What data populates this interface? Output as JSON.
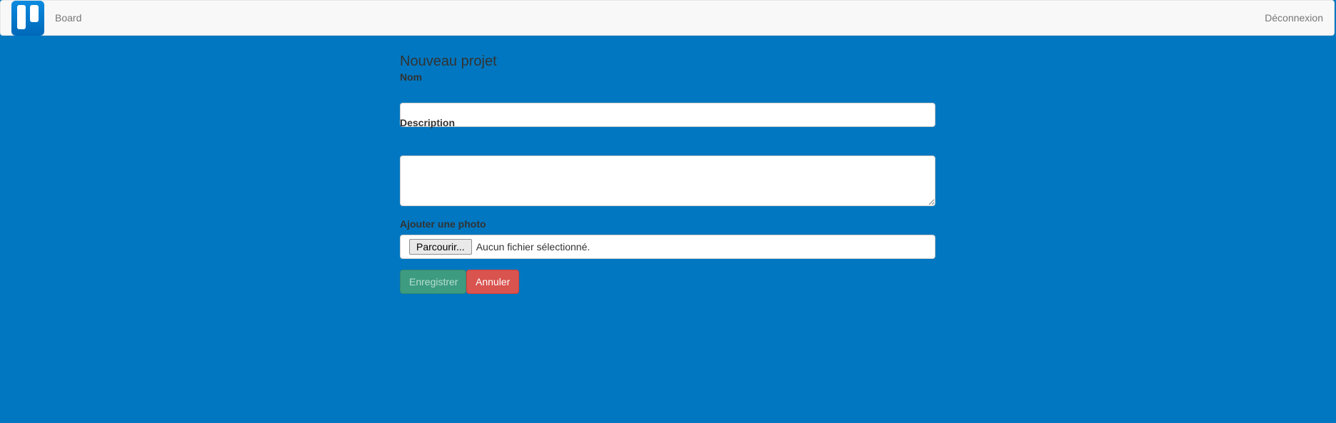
{
  "navbar": {
    "brand_link": "Board",
    "logout_link": "Déconnexion"
  },
  "form": {
    "title": "Nouveau projet",
    "name_label": "Nom",
    "name_value": "",
    "description_label": "Description",
    "description_value": "",
    "photo_label": "Ajouter une photo",
    "file_button": "Parcourir...",
    "file_status": "Aucun fichier sélectionné.",
    "save_button": "Enregistrer",
    "cancel_button": "Annuler"
  },
  "colors": {
    "background": "#0077c0",
    "navbar": "#f8f8f8",
    "save_button": "#3d9b80",
    "cancel_button": "#d9534f"
  },
  "icons": {
    "brand": "trello-logo-icon"
  }
}
